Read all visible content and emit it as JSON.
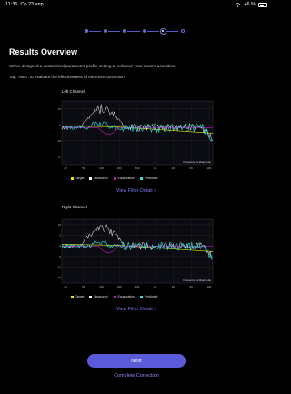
{
  "status": {
    "time": "11:36",
    "date": "Ср 23 апр.",
    "battery": "46 %"
  },
  "stepper": {
    "steps": 6,
    "current": 5
  },
  "page": {
    "title": "Results Overview",
    "description1": "We've designed a customized parametric profile setting to enhance your room's acoustics.",
    "description2": "Tap \"Next\" to evaluate the effectiveness of the room correction."
  },
  "charts": [
    {
      "channel": "Left Channel",
      "y_ticks": [
        "10",
        "0",
        "-10",
        "-20"
      ],
      "x_ticks": [
        "20",
        "50",
        "100",
        "200",
        "500",
        "1K",
        "2K",
        "5K",
        "10K"
      ],
      "caption": "Frequency vs Magnitude",
      "view_filter": "View Filter Detail >"
    },
    {
      "channel": "Right Channel",
      "y_ticks": [
        "10",
        "5",
        "0",
        "-5",
        "-10",
        "-15"
      ],
      "x_ticks": [
        "20",
        "50",
        "100",
        "200",
        "500",
        "1K",
        "2K",
        "5K",
        "10K"
      ],
      "caption": "Frequency vs Magnitude",
      "view_filter": "View Filter Detail >"
    }
  ],
  "legend": {
    "target": "Target",
    "measured": "Measured",
    "equalization": "Equalization",
    "predicted": "Predicted"
  },
  "colors": {
    "accent": "#5b5bd9",
    "link": "#7b7bf0",
    "target": "#e8e800",
    "measured": "#ffffff",
    "equalization": "#c21ac2",
    "predicted": "#2ee6d6"
  },
  "actions": {
    "next": "Next",
    "complete": "Complete Correction"
  }
}
